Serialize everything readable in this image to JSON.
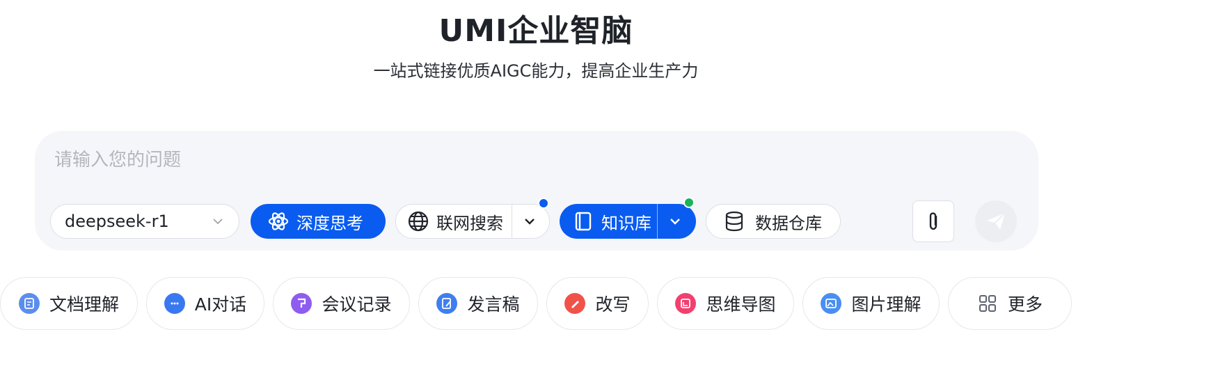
{
  "header": {
    "title": "UMI企业智脑",
    "subtitle": "一站式链接优质AIGC能力，提高企业生产力"
  },
  "chat": {
    "placeholder": "请输入您的问题",
    "model": "deepseek-r1",
    "deep_think_label": "深度思考",
    "web_search_label": "联网搜索",
    "knowledge_base_label": "知识库",
    "data_warehouse_label": "数据仓库"
  },
  "colors": {
    "primary": "#0a5cf0",
    "web_dot": "#0a5cf0",
    "kb_dot": "#19b45a",
    "chat_bg": "#f5f6fa"
  },
  "quick_actions": [
    {
      "label": "文档理解",
      "icon": "doc-edit-icon",
      "color": "#5b8def"
    },
    {
      "label": "AI对话",
      "icon": "chat-bubble-icon",
      "color": "#3a78f2"
    },
    {
      "label": "会议记录",
      "icon": "meeting-icon",
      "color": "#8f5cf0"
    },
    {
      "label": "发言稿",
      "icon": "speech-icon",
      "color": "#3f7ef0"
    },
    {
      "label": "改写",
      "icon": "pen-icon",
      "color": "#f0524a"
    },
    {
      "label": "思维导图",
      "icon": "mindmap-icon",
      "color": "#f2406e"
    },
    {
      "label": "图片理解",
      "icon": "image-icon",
      "color": "#4a8ff0"
    },
    {
      "label": "更多",
      "icon": "grid-icon",
      "color": "#5c6370"
    }
  ]
}
